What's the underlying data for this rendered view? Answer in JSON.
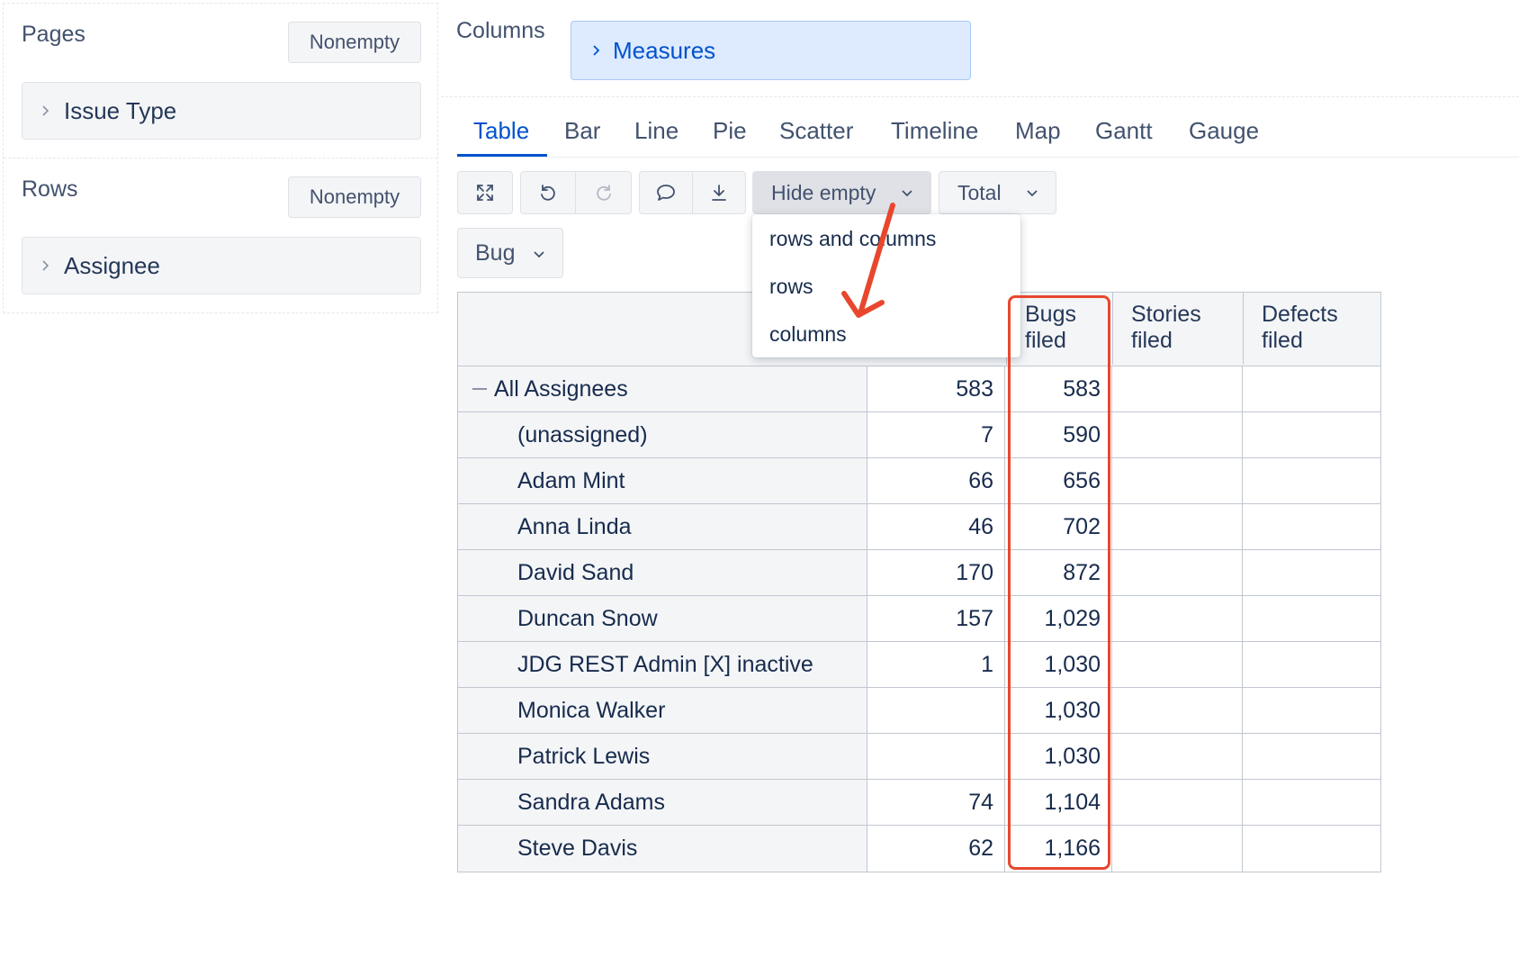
{
  "pages": {
    "title": "Pages",
    "nonempty_label": "Nonempty",
    "dimension": "Issue Type"
  },
  "rows": {
    "title": "Rows",
    "nonempty_label": "Nonempty",
    "dimension": "Assignee"
  },
  "columns": {
    "title": "Columns",
    "dimension": "Measures"
  },
  "tabs": [
    "Table",
    "Bar",
    "Line",
    "Pie",
    "Scatter",
    "Timeline",
    "Map",
    "Gantt",
    "Gauge"
  ],
  "active_tab": "Table",
  "toolbar": {
    "icons": [
      "fullscreen-icon",
      "undo-icon",
      "redo-icon",
      "comment-icon",
      "download-icon"
    ],
    "hide_empty_label": "Hide empty",
    "total_label": "Total",
    "filter_label": "Bug"
  },
  "hide_empty_menu": {
    "items": [
      "rows and columns",
      "rows",
      "columns"
    ]
  },
  "table": {
    "headers": [
      "Bugs filed",
      "Stories filed",
      "Defects filed"
    ],
    "headers_lines": [
      [
        "Bugs",
        "filed"
      ],
      [
        "Stories",
        "filed"
      ],
      [
        "Defects",
        "filed"
      ]
    ],
    "rows": [
      {
        "label": "All Assignees",
        "total": true,
        "c1": "583",
        "c2": "583",
        "c3": "",
        "c4": ""
      },
      {
        "label": "(unassigned)",
        "c1": "7",
        "c2": "590",
        "c3": "",
        "c4": ""
      },
      {
        "label": "Adam Mint",
        "c1": "66",
        "c2": "656",
        "c3": "",
        "c4": ""
      },
      {
        "label": "Anna Linda",
        "c1": "46",
        "c2": "702",
        "c3": "",
        "c4": ""
      },
      {
        "label": "David Sand",
        "c1": "170",
        "c2": "872",
        "c3": "",
        "c4": ""
      },
      {
        "label": "Duncan Snow",
        "c1": "157",
        "c2": "1,029",
        "c3": "",
        "c4": ""
      },
      {
        "label": "JDG REST Admin [X] inactive",
        "c1": "1",
        "c2": "1,030",
        "c3": "",
        "c4": ""
      },
      {
        "label": "Monica Walker",
        "c1": "",
        "c2": "1,030",
        "c3": "",
        "c4": ""
      },
      {
        "label": "Patrick Lewis",
        "c1": "",
        "c2": "1,030",
        "c3": "",
        "c4": ""
      },
      {
        "label": "Sandra Adams",
        "c1": "74",
        "c2": "1,104",
        "c3": "",
        "c4": ""
      },
      {
        "label": "Steve Davis",
        "c1": "62",
        "c2": "1,166",
        "c3": "",
        "c4": ""
      }
    ]
  },
  "colors": {
    "accent": "#0052cc",
    "annotation": "#e8472e",
    "chip_bg": "#f4f5f7",
    "measures_bg": "#deebff"
  }
}
